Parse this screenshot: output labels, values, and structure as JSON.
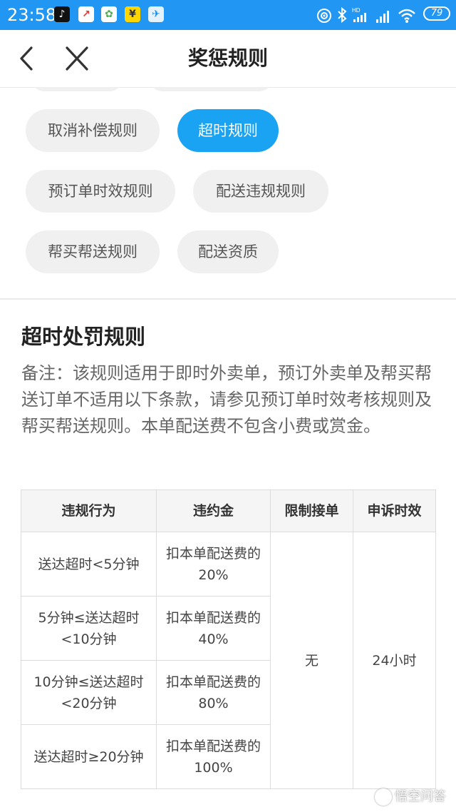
{
  "status_bar": {
    "time": "23:58",
    "battery": "79",
    "app_icons": [
      "tiktok-icon",
      "stocks-icon",
      "photos-icon",
      "yuan-app-icon",
      "map-app-icon"
    ],
    "system_icons": [
      "hotspot-icon",
      "bluetooth-icon",
      "hd-signal-icon",
      "signal-icon",
      "wifi-icon",
      "battery-icon"
    ],
    "colors": {
      "background": "#2196f3"
    }
  },
  "nav": {
    "title": "奖惩规则",
    "back_icon": "chevron-left-icon",
    "close_icon": "close-icon"
  },
  "chips": [
    {
      "label": "取消补偿规则",
      "active": false
    },
    {
      "label": "超时规则",
      "active": true
    },
    {
      "label": "预订单时效规则",
      "active": false
    },
    {
      "label": "配送违规规则",
      "active": false
    },
    {
      "label": "帮买帮送规则",
      "active": false
    },
    {
      "label": "配送资质",
      "active": false
    }
  ],
  "colors": {
    "chip_active": "#1aa3f2",
    "chip_inactive": "#f0f0f0"
  },
  "section": {
    "title": "超时处罚规则",
    "note": "备注：该规则适用于即时外卖单，预订外卖单及帮买帮送订单不适用以下条款，请参见预订单时效考核规则及帮买帮送规则。本单配送费不包含小费或赏金。"
  },
  "table": {
    "headers": [
      "违规行为",
      "违约金",
      "限制接单",
      "申诉时效"
    ],
    "rows": [
      {
        "behavior": "送达超时<5分钟",
        "penalty": "扣本单配送费的20%"
      },
      {
        "behavior": "5分钟≤送达超时<10分钟",
        "penalty": "扣本单配送费的40%"
      },
      {
        "behavior": "10分钟≤送达超时<20分钟",
        "penalty": "扣本单配送费的80%"
      },
      {
        "behavior": "送达超时≥20分钟",
        "penalty": "扣本单配送费的100%"
      }
    ],
    "restrict": "无",
    "appeal": "24小时"
  },
  "watermark": "悟空问答"
}
